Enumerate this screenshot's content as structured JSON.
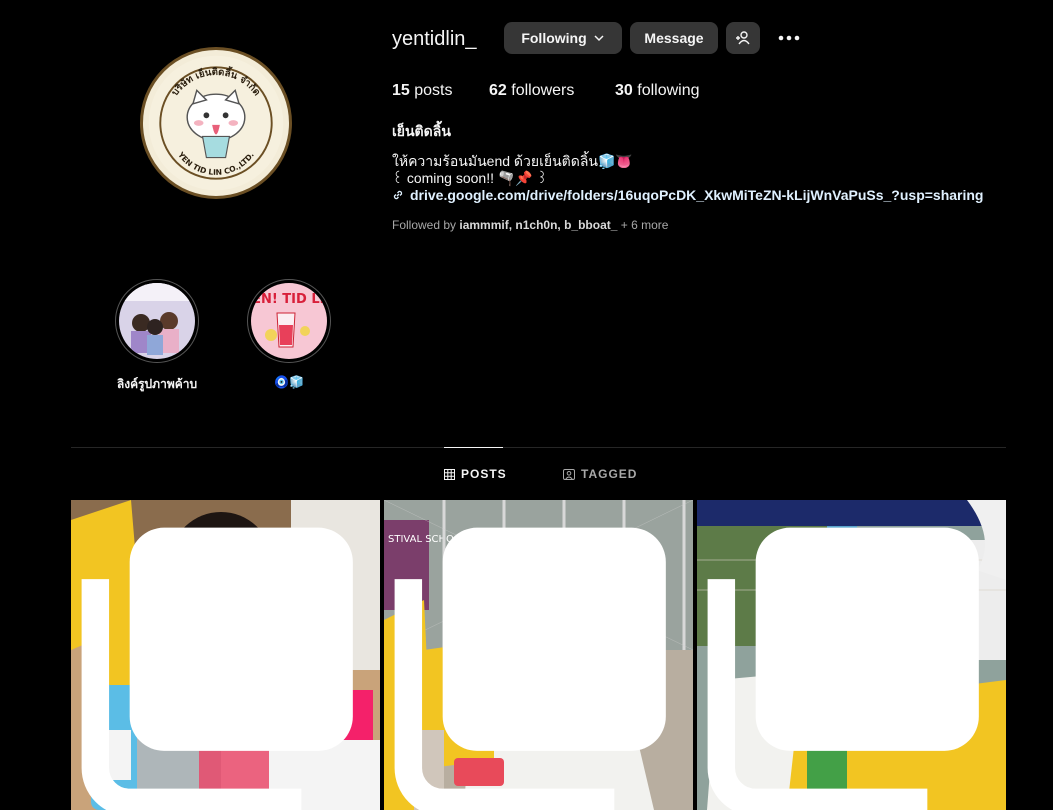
{
  "profile": {
    "username": "yentidlin_",
    "full_name": "เย็นติดลิ้น",
    "bio_line1": "ให้ความร้อนมันend ด้วยเย็นติดลิ้น🧊👅",
    "bio_line2": "꒰ coming soon!! 🫗📌 ꒱",
    "link": "drive.google.com/drive/folders/16uqoPcDK_XkwMiTeZN-kLijWnVaPuSs_?usp=sharing",
    "avatar_text_top": "บริษัท เย็นติดลิ้น จำกัด",
    "avatar_text_bottom": "YEN TID LIN CO.,LTD."
  },
  "actions": {
    "following_label": "Following",
    "message_label": "Message"
  },
  "stats": {
    "posts_count": "15",
    "posts_label": "posts",
    "followers_count": "62",
    "followers_label": "followers",
    "following_count": "30",
    "following_label": "following"
  },
  "followed_by": {
    "prefix": "Followed by",
    "names": "iammmif, n1ch0n, b_bboat_",
    "more": "+ 6 more"
  },
  "highlights": [
    {
      "label": "ลิงค์รูปภาพค้าบ"
    },
    {
      "label": "🧿🧊",
      "cover_text": "YEN! TID LIN"
    }
  ],
  "tabs": [
    {
      "label": "POSTS",
      "active": true
    },
    {
      "label": "TAGGED",
      "active": false
    }
  ],
  "posts": [
    {
      "type": "carousel"
    },
    {
      "type": "carousel",
      "banner_text": "STIVAL SCHOOL"
    },
    {
      "type": "carousel"
    }
  ],
  "colors": {
    "background": "#000000",
    "button": "#363636",
    "muted_text": "#a8a8a8",
    "link": "#e0f1ff"
  },
  "icons": {
    "following_chevron": "chevron-down-icon",
    "add_user": "add-user-icon",
    "more": "more-horizontal-icon",
    "link": "link-icon",
    "posts_tab": "grid-icon",
    "tagged_tab": "tagged-icon",
    "carousel": "carousel-icon"
  }
}
